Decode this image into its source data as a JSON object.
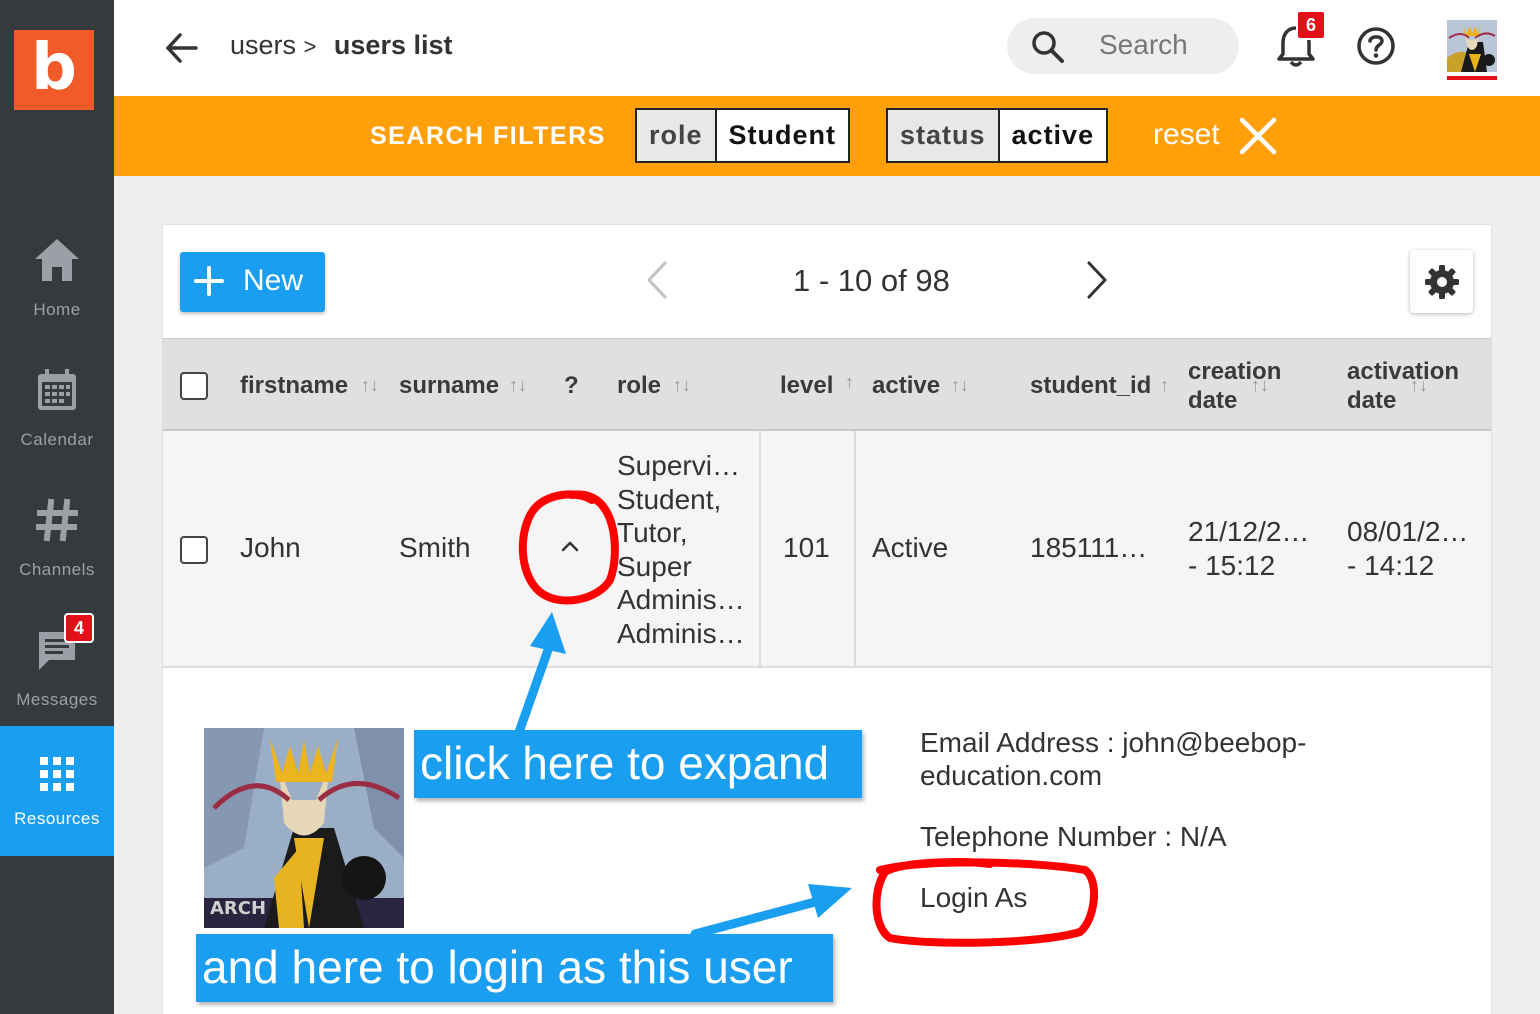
{
  "sidebar": {
    "logo": "b",
    "items": [
      {
        "label": "Home",
        "icon": "home-icon"
      },
      {
        "label": "Calendar",
        "icon": "calendar-icon"
      },
      {
        "label": "Channels",
        "icon": "hash-icon"
      },
      {
        "label": "Messages",
        "icon": "chat-icon",
        "badge": "4"
      },
      {
        "label": "Resources",
        "icon": "grid-icon",
        "active": true
      }
    ]
  },
  "topbar": {
    "breadcrumb_parent": "users",
    "breadcrumb_sep": ">",
    "breadcrumb_current": "users list",
    "search_placeholder": "Search",
    "notifications_count": "6"
  },
  "filters": {
    "title": "SEARCH FILTERS",
    "chips": [
      {
        "key": "role",
        "value": "Student"
      },
      {
        "key": "status",
        "value": "active"
      }
    ],
    "reset_label": "reset"
  },
  "toolbar": {
    "new_label": "New",
    "pagination": "1 - 10 of 98"
  },
  "table": {
    "columns": {
      "firstname": "firstname",
      "surname": "surname",
      "expand": "?",
      "role": "role",
      "level": "level",
      "active": "active",
      "student_id": "student_id",
      "creation_line1": "creation",
      "creation_line2": "date",
      "activation_line1": "activation",
      "activation_line2": "date"
    },
    "rows": [
      {
        "firstname": "John",
        "surname": "Smith",
        "roles": [
          "Supervi…",
          "Student,",
          "Tutor,",
          "Super",
          "Adminis…",
          "Adminis…"
        ],
        "level": "101",
        "active": "Active",
        "student_id": "185111…",
        "creation_line1": "21/12/2…",
        "creation_line2": "- 15:12",
        "activation_line1": "08/01/2…",
        "activation_line2": "- 14:12"
      }
    ]
  },
  "detail": {
    "email_line1": "Email Address : john@beebop-",
    "email_line2": "education.com",
    "telephone": "Telephone Number : N/A",
    "login_as": "Login As"
  },
  "annotations": {
    "expand_callout": "click here to expand",
    "login_callout": "and here to login as this user"
  },
  "colors": {
    "sidebar": "#353a3e",
    "brand": "#f15a29",
    "accent": "#1a9ff0",
    "filter_bar": "#ff9f0a",
    "badge": "#e3101a",
    "annotation_red": "#ff0000"
  }
}
